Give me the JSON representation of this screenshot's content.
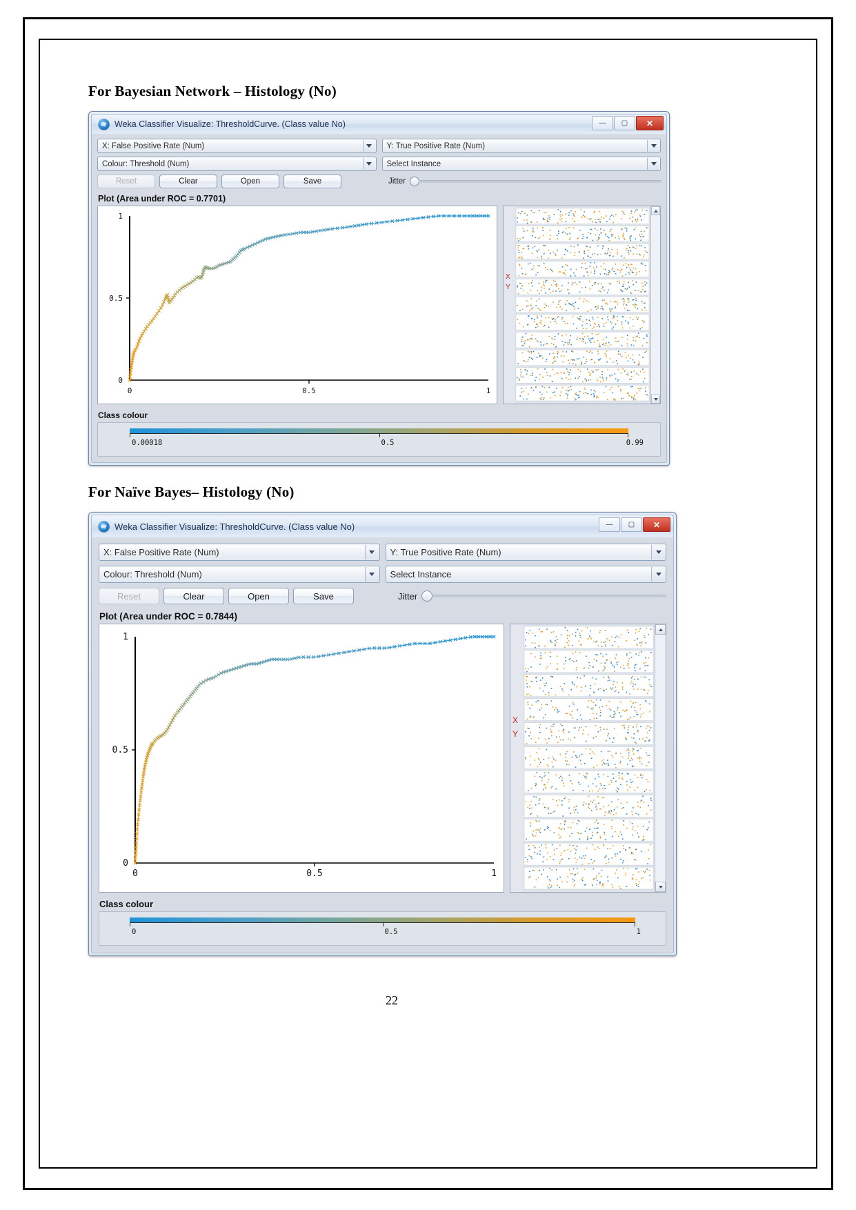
{
  "document": {
    "page_number": "22",
    "sections": [
      {
        "heading": "For Bayesian Network – Histology (No)",
        "window": {
          "title": "Weka Classifier Visualize: ThresholdCurve. (Class value No)",
          "window_buttons": {
            "minimize": "—",
            "maximize": "▢",
            "close": "✕"
          },
          "x_axis_combo": "X: False Positive Rate (Num)",
          "y_axis_combo": "Y: True Positive Rate (Num)",
          "colour_combo": "Colour: Threshold (Num)",
          "instance_combo": "Select Instance",
          "buttons": {
            "reset": "Reset",
            "clear": "Clear",
            "open": "Open",
            "save": "Save"
          },
          "jitter_label": "Jitter",
          "plot_title": "Plot (Area under ROC = 0.7701)",
          "side_x_label": "X",
          "side_y_label": "Y",
          "class_colour_label": "Class colour",
          "class_colour_ticks": [
            "0.00018",
            "0.5",
            "0.99"
          ]
        },
        "chart_data": {
          "type": "line",
          "title": "Plot (Area under ROC = 0.7701)",
          "xlabel": "False Positive Rate",
          "ylabel": "True Positive Rate",
          "xlim": [
            0,
            1
          ],
          "ylim": [
            0,
            1
          ],
          "xticks": [
            "0",
            "0.5",
            "1"
          ],
          "yticks": [
            "0",
            "0.5",
            "1"
          ],
          "grid": false,
          "legend": "none",
          "area_under_roc": 0.7701,
          "colour_scale": {
            "name": "Threshold",
            "min": 0.00018,
            "mid": 0.5,
            "max": 0.99,
            "low_color": "#1f93d8",
            "high_color": "#f79a12"
          },
          "series": [
            {
              "name": "ROC curve",
              "x": [
                0.0,
                0.003,
                0.006,
                0.009,
                0.012,
                0.02,
                0.028,
                0.038,
                0.05,
                0.062,
                0.075,
                0.09,
                0.1,
                0.105,
                0.11,
                0.12,
                0.13,
                0.145,
                0.16,
                0.175,
                0.19,
                0.2,
                0.205,
                0.21,
                0.22,
                0.235,
                0.25,
                0.265,
                0.28,
                0.29,
                0.3,
                0.31,
                0.32,
                0.34,
                0.36,
                0.38,
                0.4,
                0.42,
                0.45,
                0.48,
                0.5,
                0.53,
                0.56,
                0.6,
                0.63,
                0.66,
                0.7,
                0.74,
                0.78,
                0.82,
                0.86,
                0.9,
                0.94,
                0.97,
                1.0
              ],
              "y": [
                0.0,
                0.06,
                0.1,
                0.14,
                0.17,
                0.2,
                0.25,
                0.29,
                0.33,
                0.36,
                0.4,
                0.45,
                0.5,
                0.52,
                0.47,
                0.5,
                0.53,
                0.56,
                0.58,
                0.6,
                0.63,
                0.62,
                0.66,
                0.69,
                0.68,
                0.68,
                0.7,
                0.71,
                0.72,
                0.74,
                0.76,
                0.79,
                0.8,
                0.82,
                0.84,
                0.86,
                0.87,
                0.88,
                0.89,
                0.9,
                0.9,
                0.91,
                0.92,
                0.93,
                0.94,
                0.95,
                0.96,
                0.97,
                0.98,
                0.99,
                1.0,
                1.0,
                1.0,
                1.0,
                1.0
              ]
            }
          ]
        }
      },
      {
        "heading": "For Naïve Bayes– Histology (No)",
        "window": {
          "title": "Weka Classifier Visualize: ThresholdCurve. (Class value No)",
          "window_buttons": {
            "minimize": "—",
            "maximize": "▢",
            "close": "✕"
          },
          "x_axis_combo": "X: False Positive Rate (Num)",
          "y_axis_combo": "Y: True Positive Rate (Num)",
          "colour_combo": "Colour: Threshold (Num)",
          "instance_combo": "Select Instance",
          "buttons": {
            "reset": "Reset",
            "clear": "Clear",
            "open": "Open",
            "save": "Save"
          },
          "jitter_label": "Jitter",
          "plot_title": "Plot (Area under ROC = 0.7844)",
          "side_x_label": "X",
          "side_y_label": "Y",
          "class_colour_label": "Class colour",
          "class_colour_ticks": [
            "0",
            "0.5",
            "1"
          ]
        },
        "chart_data": {
          "type": "line",
          "title": "Plot (Area under ROC = 0.7844)",
          "xlabel": "False Positive Rate",
          "ylabel": "True Positive Rate",
          "xlim": [
            0,
            1
          ],
          "ylim": [
            0,
            1
          ],
          "xticks": [
            "0",
            "0.5",
            "1"
          ],
          "yticks": [
            "0",
            "0.5",
            "1"
          ],
          "grid": false,
          "legend": "none",
          "area_under_roc": 0.7844,
          "colour_scale": {
            "name": "Threshold",
            "min": 0,
            "mid": 0.5,
            "max": 1,
            "low_color": "#1f93d8",
            "high_color": "#f79a12"
          },
          "series": [
            {
              "name": "ROC curve",
              "x": [
                0.0,
                0.002,
                0.004,
                0.006,
                0.01,
                0.014,
                0.018,
                0.022,
                0.026,
                0.03,
                0.035,
                0.04,
                0.045,
                0.05,
                0.06,
                0.07,
                0.08,
                0.09,
                0.1,
                0.11,
                0.12,
                0.13,
                0.14,
                0.15,
                0.16,
                0.17,
                0.18,
                0.2,
                0.22,
                0.24,
                0.26,
                0.28,
                0.3,
                0.32,
                0.34,
                0.36,
                0.38,
                0.4,
                0.43,
                0.46,
                0.5,
                0.54,
                0.58,
                0.62,
                0.66,
                0.7,
                0.74,
                0.78,
                0.82,
                0.86,
                0.9,
                0.94,
                0.97,
                1.0
              ],
              "y": [
                0.0,
                0.05,
                0.1,
                0.16,
                0.22,
                0.28,
                0.33,
                0.38,
                0.42,
                0.45,
                0.48,
                0.5,
                0.52,
                0.53,
                0.55,
                0.56,
                0.57,
                0.59,
                0.62,
                0.65,
                0.67,
                0.69,
                0.71,
                0.73,
                0.75,
                0.77,
                0.79,
                0.81,
                0.82,
                0.84,
                0.85,
                0.86,
                0.87,
                0.88,
                0.88,
                0.89,
                0.9,
                0.9,
                0.9,
                0.91,
                0.91,
                0.92,
                0.93,
                0.94,
                0.95,
                0.95,
                0.96,
                0.97,
                0.97,
                0.98,
                0.99,
                1.0,
                1.0,
                1.0
              ]
            }
          ]
        }
      }
    ]
  }
}
